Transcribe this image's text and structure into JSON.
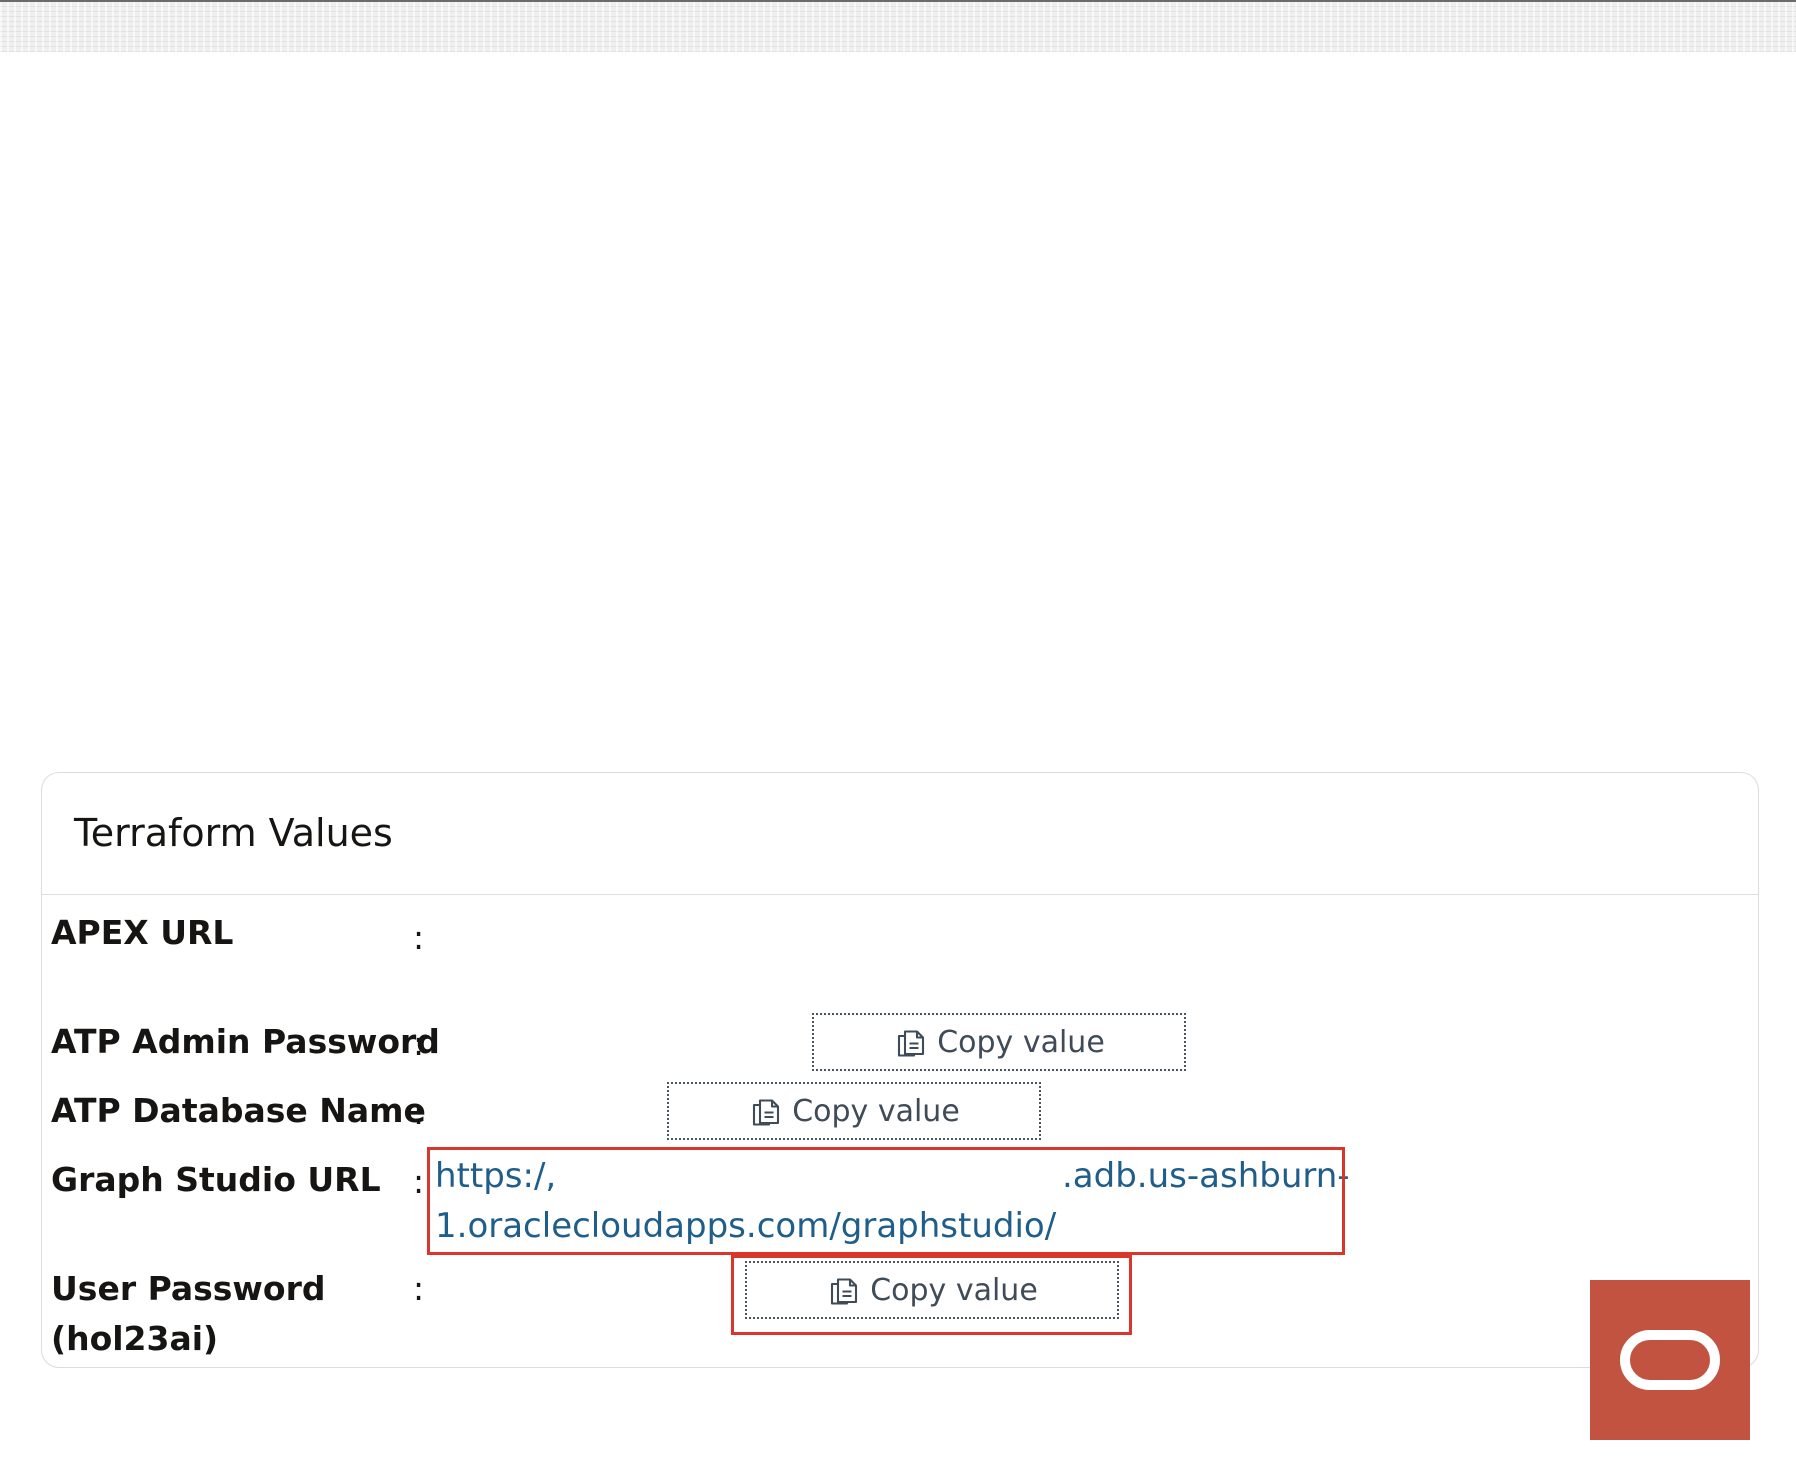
{
  "panel": {
    "title": "Terraform Values",
    "rows": [
      {
        "label": "APEX URL",
        "separator": ":"
      },
      {
        "label": "ATP Admin Password",
        "separator": ":",
        "button_label": "Copy value",
        "button_icon": "copy-icon"
      },
      {
        "label": "ATP Database Name",
        "separator": ":",
        "button_label": "Copy value",
        "button_icon": "copy-icon"
      },
      {
        "label": "Graph Studio URL",
        "separator": ":",
        "url_part_1": "https:/,",
        "url_part_2": ".adb.us-ashburn-",
        "url_line_2": "1.oraclecloudapps.com/graphstudio/"
      },
      {
        "label_line_1": "User Password",
        "label_line_2": "(hol23ai)",
        "separator": ":",
        "button_label": "Copy value",
        "button_icon": "copy-icon"
      }
    ]
  },
  "colors": {
    "link": "#1f5e8a",
    "highlight": "#d9372b",
    "oracle_badge": "#c25340"
  },
  "oracle_badge": {
    "icon": "oracle-logo-icon"
  }
}
